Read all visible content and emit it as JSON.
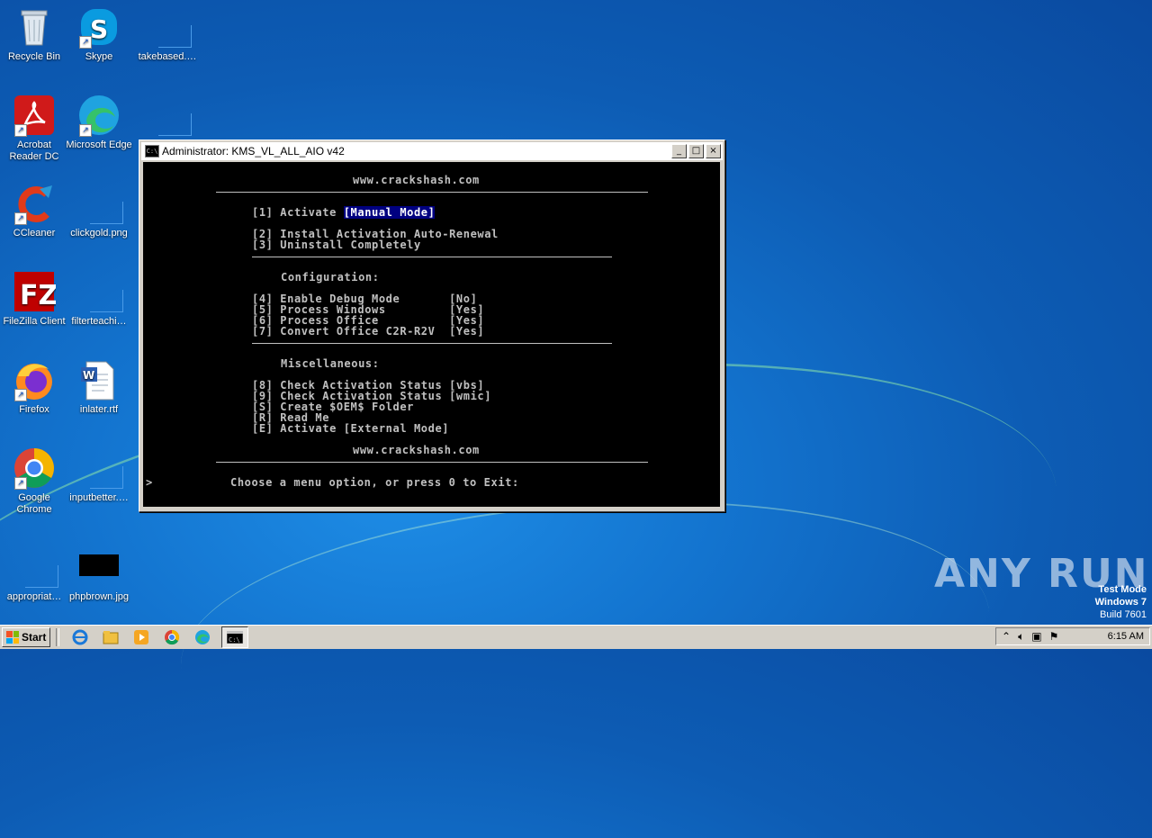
{
  "desktop_icons": [
    {
      "label": "Recycle Bin",
      "icon": "recycle-bin-icon"
    },
    {
      "label": "Skype",
      "icon": "skype-icon"
    },
    {
      "label": "takebased.…",
      "icon": "blank-file-icon"
    },
    {
      "label": "Acrobat Reader DC",
      "label_line1": "Acrobat",
      "label_line2": "Reader DC",
      "icon": "acrobat-icon"
    },
    {
      "label": "Microsoft Edge",
      "icon": "edge-icon"
    },
    {
      "label": "CCleaner",
      "icon": "ccleaner-icon"
    },
    {
      "label": "clickgold.png",
      "icon": "blank-file-icon"
    },
    {
      "label": "FileZilla Client",
      "icon": "filezilla-icon"
    },
    {
      "label": "filterteachi…",
      "icon": "blank-file-icon"
    },
    {
      "label": "Firefox",
      "icon": "firefox-icon"
    },
    {
      "label": "inlater.rtf",
      "icon": "word-doc-icon"
    },
    {
      "label": "Google Chrome",
      "label_line1": "Google",
      "label_line2": "Chrome",
      "icon": "chrome-icon"
    },
    {
      "label": "inputbetter.…",
      "icon": "blank-file-icon"
    },
    {
      "label": "appropriat…",
      "icon": "blank-file-icon"
    },
    {
      "label": "phpbrown.jpg",
      "icon": "black-image-icon"
    }
  ],
  "window": {
    "title": "Administrator:  KMS_VL_ALL_AIO v42",
    "icon_text": "C:\\",
    "buttons": {
      "minimize": "_",
      "maximize": "□",
      "close": "×"
    }
  },
  "console": {
    "site_top": "www.crackshash.com",
    "opt1": "[1] Activate ",
    "opt1_mode": "[Manual Mode]",
    "opt2": "[2] Install Activation Auto-Renewal",
    "opt3": "[3] Uninstall Completely",
    "config_header": "Configuration:",
    "opt4": "[4] Enable Debug Mode       [No]",
    "opt5": "[5] Process Windows         [Yes]",
    "opt6": "[6] Process Office          [Yes]",
    "opt7": "[7] Convert Office C2R-R2V  [Yes]",
    "misc_header": "Miscellaneous:",
    "opt8": "[8] Check Activation Status [vbs]",
    "opt9": "[9] Check Activation Status [wmic]",
    "optS": "[S] Create $OEM$ Folder",
    "optR": "[R] Read Me",
    "optE": "[E] Activate [External Mode]",
    "site_bottom": "www.crackshash.com",
    "prompt_arrow": ">",
    "prompt": "Choose a menu option, or press 0 to Exit:"
  },
  "taskbar": {
    "start_label": "Start",
    "pinned": [
      "ie-icon",
      "explorer-icon",
      "media-player-icon",
      "chrome-icon",
      "edge-icon"
    ],
    "active_task_icon": "cmd-icon",
    "clock": "6:15 AM"
  },
  "watermark": {
    "line1": "Test Mode",
    "line2": "Windows 7",
    "line3": "Build 7601"
  },
  "brand_overlay": "ANY RUN",
  "colors": {
    "desktop": "#1374cf",
    "console_bg": "#000000",
    "console_text": "#c0c0c0",
    "highlight_bg": "#000080",
    "window_chrome": "#d4d0c8"
  }
}
